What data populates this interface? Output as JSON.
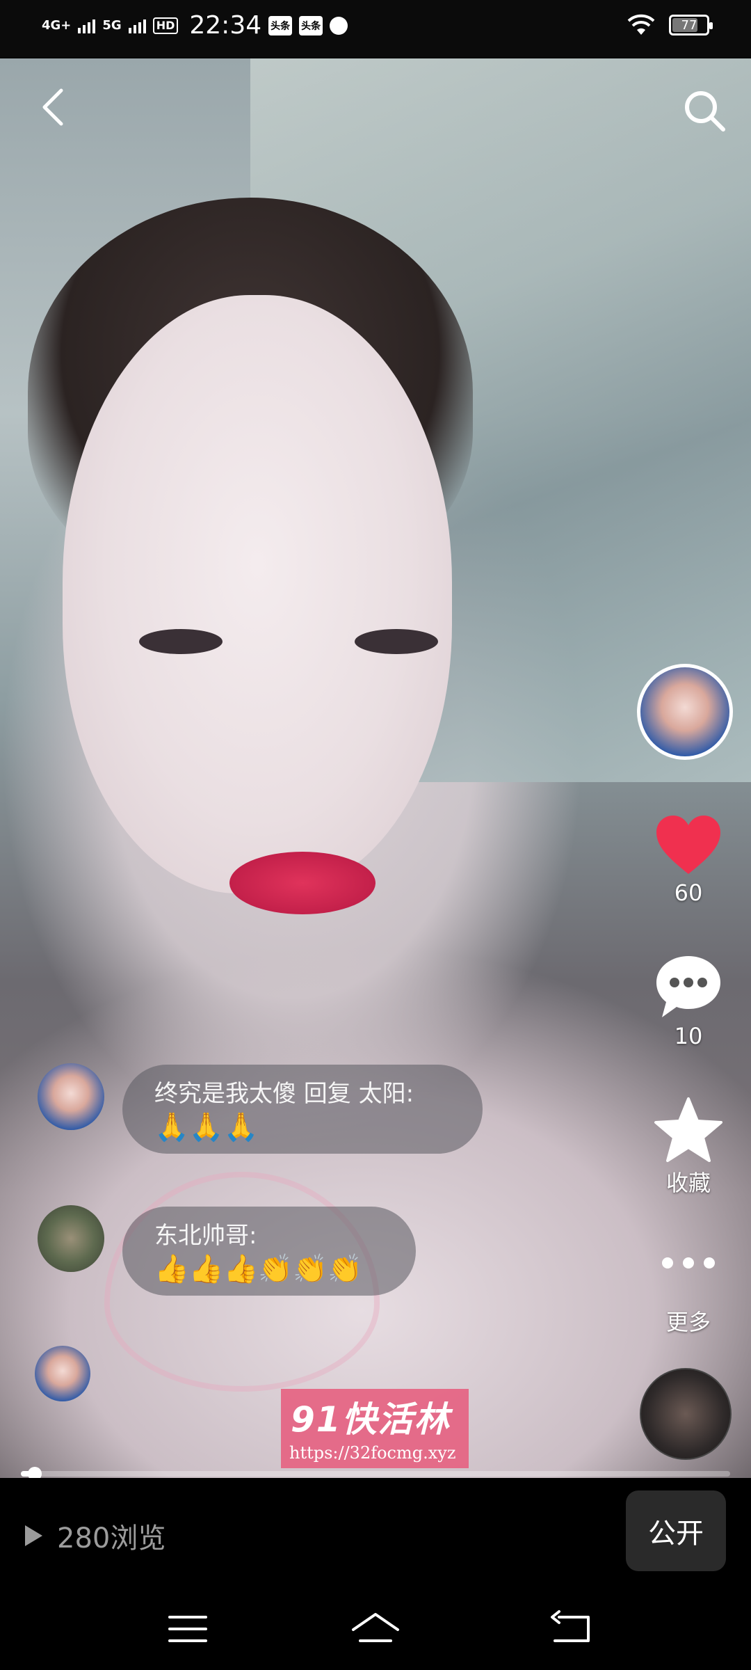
{
  "status_bar": {
    "network_1": "4G+",
    "network_2": "5G",
    "hd": "HD",
    "time": "22:34",
    "app_badge_1": "头条",
    "app_badge_2": "头条",
    "battery": "77"
  },
  "video": {
    "likes": "60",
    "comments": "10",
    "favorite_label": "收藏",
    "more_label": "更多",
    "progress_fraction": 0.02
  },
  "danmaku": [
    {
      "text": "终究是我太傻 回复 太阳:",
      "emoji": "🙏🙏🙏"
    },
    {
      "text": "东北帅哥:",
      "emoji": "👍👍👍👏👏👏"
    }
  ],
  "watermark": {
    "title": "91快活林",
    "url": "https://32focmg.xyz"
  },
  "bottom": {
    "views": "280浏览",
    "public_button": "公开"
  },
  "icons": {
    "back": "chevron-left-icon",
    "search": "search-icon",
    "like": "heart-icon",
    "comment": "chat-bubble-icon",
    "favorite": "star-icon",
    "more": "three-dots-icon",
    "play": "play-icon",
    "nav_menu": "menu-icon",
    "nav_home": "home-icon",
    "nav_back": "back-arrow-icon"
  },
  "colors": {
    "like_red": "#f0304f",
    "watermark_pink": "#e56181",
    "button_bg": "#2a2a2a"
  }
}
